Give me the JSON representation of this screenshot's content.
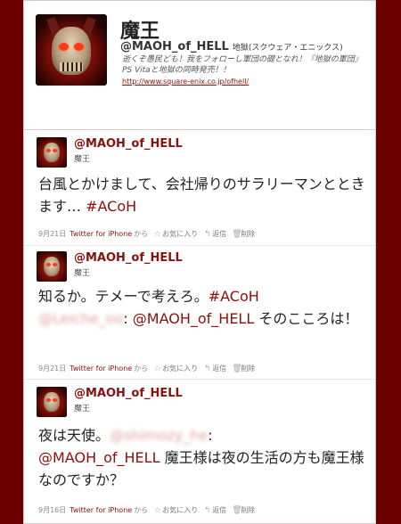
{
  "profile": {
    "name": "魔王",
    "handle": "@MAOH_of_HELL",
    "sub": "地獄(スクウェア・エニックス)",
    "bio": "逝くぞ愚民ども！我をフォローし軍団の礎となれ！『地獄の軍団』PS Vitaと地獄の同時発売！！",
    "url": "http://www.square-enix.co.jp/ofhell/"
  },
  "tweets": [
    {
      "handle": "@MAOH_of_HELL",
      "name": "魔王",
      "text": "台風とかけまして、会社帰りのサラリーマンとときます… ",
      "hashtag": "#ACoH",
      "date": "9月21日",
      "source": "Twitter for iPhone",
      "source_suffix": "から",
      "fav": "お気に入り",
      "reply": "返信",
      "delete": "削除"
    },
    {
      "handle": "@MAOH_of_HELL",
      "name": "魔王",
      "text_a": "知るか。テメーで考えろ。",
      "hashtag": "#ACoH",
      "mention_blur": "@Leiche_oo",
      "sep": ": ",
      "mention": "@MAOH_of_HELL",
      "text_b": " そのこころは！",
      "date": "9月21日",
      "source": "Twitter for iPhone",
      "source_suffix": "から",
      "fav": "お気に入り",
      "reply": "返信",
      "delete": "削除"
    },
    {
      "handle": "@MAOH_of_HELL",
      "name": "魔王",
      "text_a": "夜は天使。",
      "mention_blur": "@shimozy_he",
      "sep": ":",
      "mention": "@MAOH_of_HELL",
      "text_b": " 魔王様は夜の生活の方も魔王様なのですか？",
      "date": "9月16日",
      "source": "Twitter for iPhone",
      "source_suffix": "から",
      "fav": "お気に入り",
      "reply": "返信",
      "delete": "削除"
    }
  ],
  "icons": {
    "fav": "star-icon",
    "reply": "reply-icon",
    "delete": "trash-icon"
  },
  "colors": {
    "background": "#6b0000",
    "link": "#8a1010"
  }
}
